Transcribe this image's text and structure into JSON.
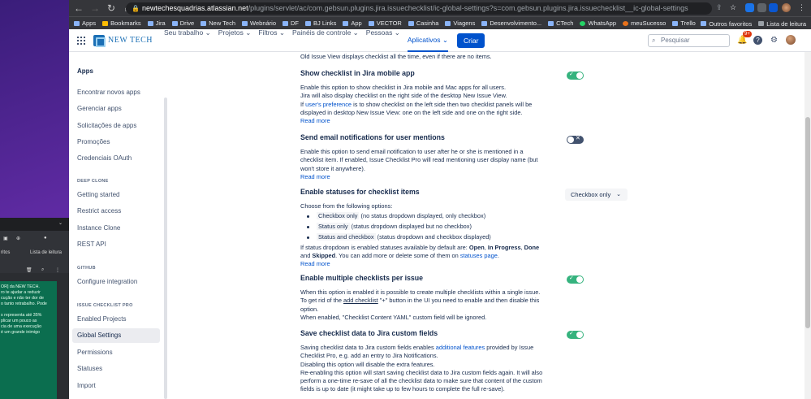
{
  "browser": {
    "url_host": "newtechesquadrias.atlassian.net",
    "url_path": "/plugins/servlet/ac/com.gebsun.plugins.jira.issuechecklist/ic-global-settings?s=com.gebsun.plugins.jira.issuechecklist__ic-global-settings",
    "bookmarks": [
      "Apps",
      "Bookmarks",
      "Jira",
      "Drive",
      "New Tech",
      "Webnário",
      "DF",
      "BJ Links",
      "App",
      "VECTOR",
      "Casinha",
      "Viagens",
      "Desenvolvimento...",
      "CTech",
      "WhatsApp",
      "meuSucesso",
      "Trello"
    ],
    "bookmarks_right": [
      "Outros favoritos",
      "Lista de leitura"
    ]
  },
  "header": {
    "logo_text": "NEW TECH",
    "nav": [
      "Seu trabalho",
      "Projetos",
      "Filtros",
      "Painéis de controle",
      "Pessoas",
      "Aplicativos"
    ],
    "create_label": "Criar",
    "search_placeholder": "Pesquisar",
    "notifications_badge": "9+"
  },
  "sidebar": {
    "title": "Apps",
    "items_apps": [
      "Encontrar novos apps",
      "Gerenciar apps",
      "Solicitações de apps",
      "Promoções",
      "Credenciais OAuth"
    ],
    "sec_deep_clone": "DEEP CLONE",
    "items_deep_clone": [
      "Getting started",
      "Restrict access",
      "Instance Clone",
      "REST API"
    ],
    "sec_github": "GITHUB",
    "items_github": [
      "Configure integration"
    ],
    "sec_issue_checklist": "ISSUE CHECKLIST PRO",
    "items_issue_checklist": [
      "Enabled Projects",
      "Global Settings",
      "Permissions",
      "Statuses",
      "Import"
    ]
  },
  "content": {
    "top_line": "Old Issue View displays checklist all the time, even if there are no items.",
    "mobile": {
      "title": "Show checklist in Jira mobile app",
      "l1": "Enable this option to show checklist in Jira mobile and Mac apps for all users.",
      "l2": "Jira will also display checklist on the right side of the desktop New Issue View.",
      "l3a": "If ",
      "l3link": "user's preference",
      "l3b": " is to show checklist on the left side then two checklist panels will be",
      "l4": "displayed in desktop New Issue View: one on the left side and one on the right side.",
      "read_more": "Read more",
      "enabled": true
    },
    "email": {
      "title": "Send email notifications for user mentions",
      "l1": "Enable this option to send email notification to user after he or she is mentioned in a",
      "l2": "checklist item. If enabled, Issue Checklist Pro will read mentioning user display name (but",
      "l3": "won't store it anywhere).",
      "read_more": "Read more",
      "enabled": false
    },
    "statuses": {
      "title": "Enable statuses for checklist items",
      "choose": "Choose from the following options:",
      "opt1a": "Checkbox only",
      "opt1b": "  (no status dropdown displayed, only checkbox)",
      "opt2a": "Status only",
      "opt2b": "  (status dropdown displayed but no checkbox)",
      "opt3a": "Status and checkbox",
      "opt3b": "  (status dropdown and checkbox displayed)",
      "l1a": "If status dropdown is enabled statuses available by default are: ",
      "open": "Open",
      "comma": ", ",
      "inprog": "In Progress",
      "comma2": ", ",
      "done": "Done",
      "l2a": "and ",
      "skipped": "Skipped",
      "l2b": ". You can add more or delete some of them on ",
      "statuses_page": "statuses page",
      "l2c": ".",
      "read_more": "Read more",
      "dropdown_value": "Checkbox only"
    },
    "multiple": {
      "title": "Enable multiple checklists per issue",
      "l1": "When this option is enabled it is possible to create multiple checklists within a single issue.",
      "l2a": "To get rid of the ",
      "l2link": "add checklist",
      "l2b": " \"+\" button in the UI you need to enable and then disable this",
      "l3": "option.",
      "l4": "When enabled, \"Checklist Content YAML\" custom field will be ignored.",
      "enabled": true
    },
    "save_fields": {
      "title": "Save checklist data to Jira custom fields",
      "l1a": "Saving checklist data to Jira custom fields enables ",
      "l1link": "additional features",
      "l1b": "  provided by Issue",
      "l2": "Checklist Pro, e.g. add an entry to Jira Notifications.",
      "l3": "Disabling this option will disable the extra features.",
      "l4": "Re-enabling this option will start saving checklist data to Jira custom fields again. It will also",
      "l5": "perform a one-time re-save of all the checklist data to make sure that content of the custom",
      "l6": "fields is up to date (it might take up to few hours to complete the full re-save).",
      "enabled": true
    }
  },
  "background_window": {
    "lines": [
      "OR] da NEW TECH.",
      "ro te ajudar a reduzir",
      "cução e não ter dor de",
      "o tanto retrabalho. Pode",
      "",
      "s representa até 35%",
      "plicar um pouco as",
      "cia de uma execução",
      "é um grande inimigo"
    ],
    "tab_text": "ritos",
    "tab_text2": "Lista de leitura"
  }
}
